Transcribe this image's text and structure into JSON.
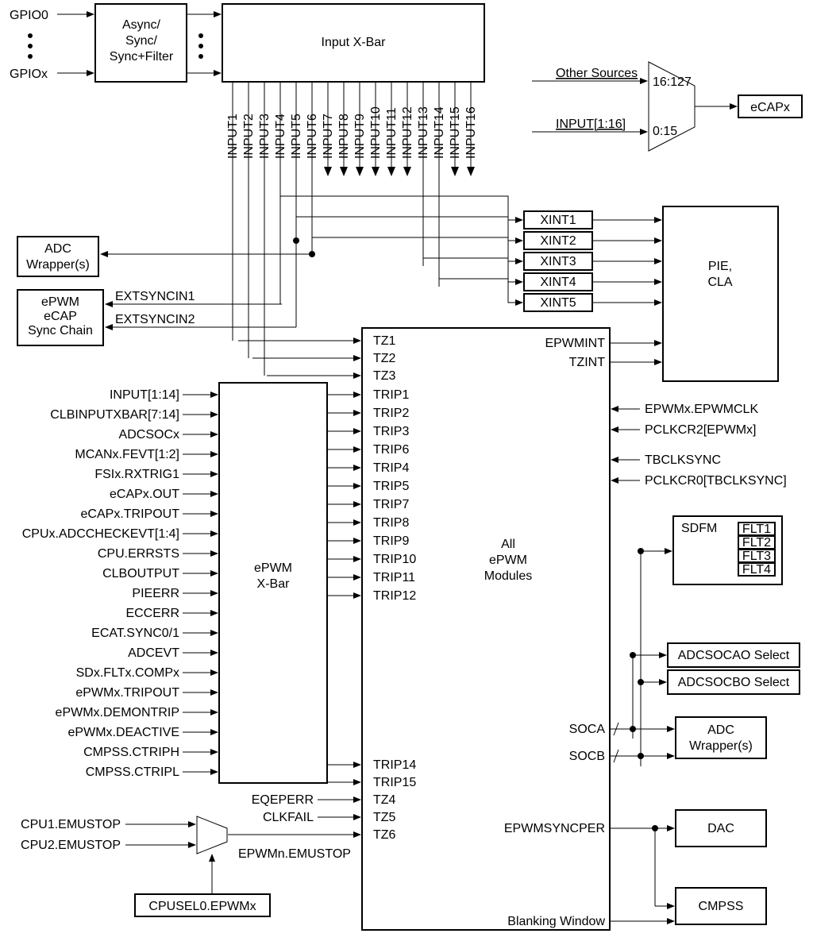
{
  "gpio0": "GPIO0",
  "gpiox": "GPIOx",
  "async": "Async/\nSync/\nSync+Filter",
  "inputxbar": "Input X-Bar",
  "other": "Other Sources",
  "input116": "INPUT[1:16]",
  "muxhi": "16:127",
  "muxlo": "0:15",
  "ecapx": "eCAPx",
  "adcwrap": "ADC\nWrapper(s)",
  "syncchain": "ePWM\neCAP\nSync Chain",
  "extsync1": "EXTSYNCIN1",
  "extsync2": "EXTSYNCIN2",
  "xint": [
    "XINT1",
    "XINT2",
    "XINT3",
    "XINT4",
    "XINT5"
  ],
  "piecla": "PIE,\nCLA",
  "epwmint": "EPWMINT",
  "tzint": "TZINT",
  "clks": [
    "EPWMx.EPWMCLK",
    "PCLKCR2[EPWMx]",
    "TBCLKSYNC",
    "PCLKCR0[TBCLKSYNC]"
  ],
  "xbarleft": [
    "INPUT[1:14]",
    "CLBINPUTXBAR[7:14]",
    "ADCSOCx",
    "MCANx.FEVT[1:2]",
    "FSIx.RXTRIG1",
    "eCAPx.OUT",
    "eCAPx.TRIPOUT",
    "CPUx.ADCCHECKEVT[1:4]",
    "CPU.ERRSTS",
    "CLBOUTPUT",
    "PIEERR",
    "ECCERR",
    "ECAT.SYNC0/1",
    "ADCEVT",
    "SDx.FLTx.COMPx",
    "ePWMx.TRIPOUT",
    "ePWMx.DEMONTRIP",
    "ePWMx.DEACTIVE",
    "CMPSS.CTRIPH",
    "CMPSS.CTRIPL"
  ],
  "epwmxbar": "ePWM\nX-Bar",
  "tz": [
    "TZ1",
    "TZ2",
    "TZ3"
  ],
  "trip": [
    "TRIP1",
    "TRIP2",
    "TRIP3",
    "TRIP6",
    "TRIP4",
    "TRIP5",
    "TRIP7",
    "TRIP8",
    "TRIP9",
    "TRIP10",
    "TRIP11",
    "TRIP12"
  ],
  "trip14": "TRIP14",
  "trip15": "TRIP15",
  "tz456": [
    "TZ4",
    "TZ5",
    "TZ6"
  ],
  "eqeperr": "EQEPERR",
  "clkfail": "CLKFAIL",
  "allmod": "All\nePWM\nModules",
  "cpu1emu": "CPU1.EMUSTOP",
  "cpu2emu": "CPU2.EMUSTOP",
  "epwmnemu": "EPWMn.EMUSTOP",
  "cpusel": "CPUSEL0.EPWMx",
  "sdfm": "SDFM",
  "flt": [
    "FLT1",
    "FLT2",
    "FLT3",
    "FLT4"
  ],
  "adcsocao": "ADCSOCAO Select",
  "adcsocbo": "ADCSOCBO Select",
  "adcwrap2": "ADC\nWrapper(s)",
  "soca": "SOCA",
  "socb": "SOCB",
  "epwmsyncper": "EPWMSYNCPER",
  "dac": "DAC",
  "cmpss": "CMPSS",
  "blank": "Blanking Window",
  "inputs": [
    "INPUT1",
    "INPUT2",
    "INPUT3",
    "INPUT4",
    "INPUT5",
    "INPUT6",
    "INPUT7",
    "INPUT8",
    "INPUT9",
    "INPUT10",
    "INPUT11",
    "INPUT12",
    "INPUT13",
    "INPUT14",
    "INPUT15",
    "INPUT16"
  ]
}
